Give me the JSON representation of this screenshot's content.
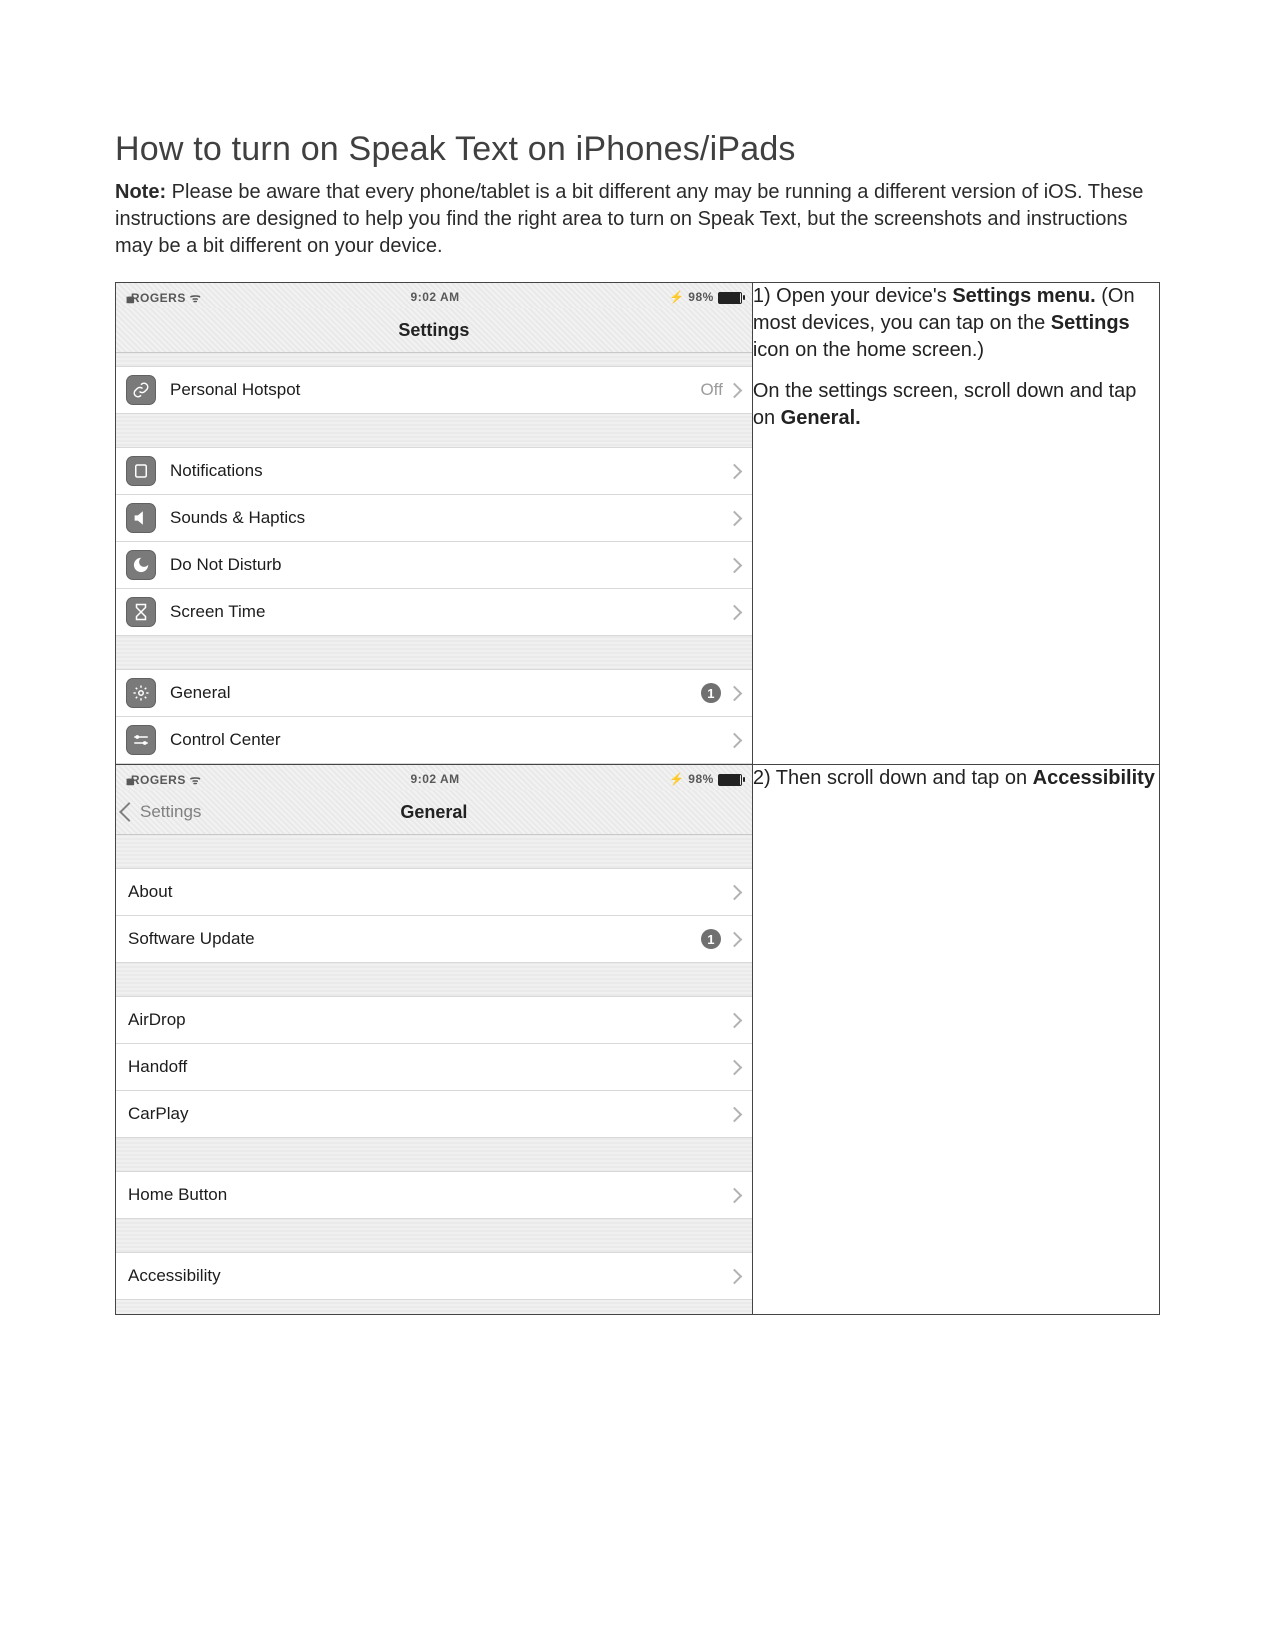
{
  "title": "How to turn on Speak Text on iPhones/iPads",
  "note_label": "Note:",
  "note_text": " Please be aware that every phone/tablet is a bit different any may be running a different version of iOS. These instructions are designed to help you find the right area to turn on Speak Text, but the screenshots and instructions may be a bit different on your device.",
  "status": {
    "carrier": "ROGERS",
    "time": "9:02 AM",
    "battery": "98%"
  },
  "step1": {
    "text_a": "1) Open your device's ",
    "bold_a": "Settings menu.",
    "text_b": " (On most devices, you can tap on the ",
    "bold_b": "Settings",
    "text_c": " icon on the home screen.)",
    "text_d": "On the settings screen, scroll down and tap on ",
    "bold_d": "General."
  },
  "step2": {
    "text_a": "2) Then scroll down and tap on ",
    "bold_a": "Accessibility"
  },
  "settings_screen": {
    "nav_title": "Settings",
    "rows": {
      "hotspot": {
        "label": "Personal Hotspot",
        "detail": "Off"
      },
      "notifications": {
        "label": "Notifications"
      },
      "sounds": {
        "label": "Sounds & Haptics"
      },
      "dnd": {
        "label": "Do Not Disturb"
      },
      "screentime": {
        "label": "Screen Time"
      },
      "general": {
        "label": "General",
        "badge": "1"
      },
      "controlcenter": {
        "label": "Control Center"
      }
    }
  },
  "general_screen": {
    "back_label": "Settings",
    "nav_title": "General",
    "rows": {
      "about": {
        "label": "About"
      },
      "swupdate": {
        "label": "Software Update",
        "badge": "1"
      },
      "airdrop": {
        "label": "AirDrop"
      },
      "handoff": {
        "label": "Handoff"
      },
      "carplay": {
        "label": "CarPlay"
      },
      "homebutton": {
        "label": "Home Button"
      },
      "accessibility": {
        "label": "Accessibility"
      }
    }
  }
}
